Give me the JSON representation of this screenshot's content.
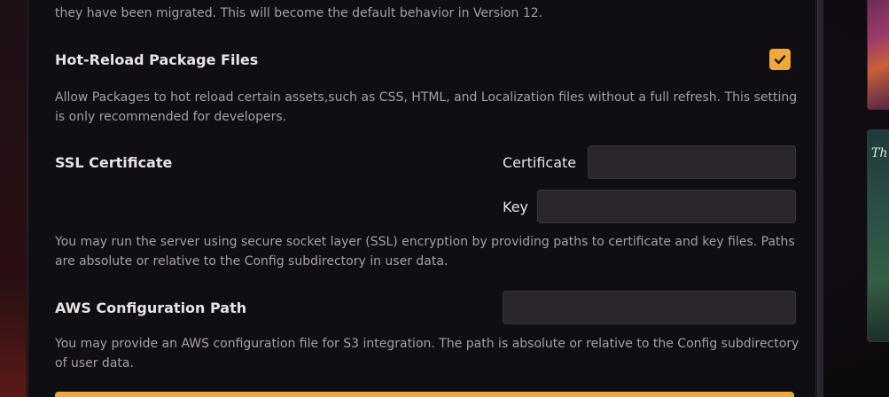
{
  "migration": {
    "description_tail": "they have been migrated. This will become the default behavior in Version 12."
  },
  "hot_reload": {
    "title": "Hot-Reload Package Files",
    "checked": true,
    "description": "Allow Packages to hot reload certain assets,such as CSS, HTML, and Localization files without a full refresh. This setting is only recommended for developers."
  },
  "ssl": {
    "title": "SSL Certificate",
    "certificate_label": "Certificate",
    "certificate_value": "",
    "key_label": "Key",
    "key_value": "",
    "description": "You may run the server using secure socket layer (SSL) encryption by providing paths to certificate and key files. Paths are absolute or relative to the Config subdirectory in user data."
  },
  "aws": {
    "title": "AWS Configuration Path",
    "path_value": "",
    "description": "You may provide an AWS configuration file for S3 integration. The path is absolute or relative to the Config subdirectory of user data."
  },
  "background": {
    "side_card_text": "Th"
  },
  "colors": {
    "accent": "#f0a73c",
    "panel_bg": "#100d13",
    "input_bg": "#2b262d",
    "text_primary": "#e8e2e6",
    "text_secondary": "#a89fa6"
  },
  "icons": {
    "checkbox": "checkmark-icon"
  }
}
